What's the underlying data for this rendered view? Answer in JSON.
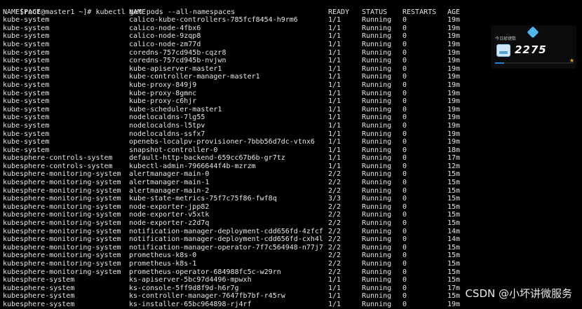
{
  "terminal": {
    "prompt": "[root@master1 ~]#",
    "command": "kubectl get pods --all-namespaces",
    "header": {
      "namespace": "NAMESPACE",
      "name": "NAME",
      "ready": "READY",
      "status": "STATUS",
      "restarts": "RESTARTS",
      "age": "AGE"
    },
    "rows": [
      {
        "namespace": "kube-system",
        "name": "calico-kube-controllers-785fcf8454-h9rm6",
        "ready": "1/1",
        "status": "Running",
        "restarts": "0",
        "age": "19m"
      },
      {
        "namespace": "kube-system",
        "name": "calico-node-4fbx6",
        "ready": "1/1",
        "status": "Running",
        "restarts": "0",
        "age": "19m"
      },
      {
        "namespace": "kube-system",
        "name": "calico-node-9zqp8",
        "ready": "1/1",
        "status": "Running",
        "restarts": "0",
        "age": "19m"
      },
      {
        "namespace": "kube-system",
        "name": "calico-node-zm77d",
        "ready": "1/1",
        "status": "Running",
        "restarts": "0",
        "age": "19m"
      },
      {
        "namespace": "kube-system",
        "name": "coredns-757cd945b-cqzr8",
        "ready": "1/1",
        "status": "Running",
        "restarts": "0",
        "age": "19m"
      },
      {
        "namespace": "kube-system",
        "name": "coredns-757cd945b-nvjwn",
        "ready": "1/1",
        "status": "Running",
        "restarts": "0",
        "age": "19m"
      },
      {
        "namespace": "kube-system",
        "name": "kube-apiserver-master1",
        "ready": "1/1",
        "status": "Running",
        "restarts": "0",
        "age": "19m"
      },
      {
        "namespace": "kube-system",
        "name": "kube-controller-manager-master1",
        "ready": "1/1",
        "status": "Running",
        "restarts": "0",
        "age": "19m"
      },
      {
        "namespace": "kube-system",
        "name": "kube-proxy-849j9",
        "ready": "1/1",
        "status": "Running",
        "restarts": "0",
        "age": "19m"
      },
      {
        "namespace": "kube-system",
        "name": "kube-proxy-8gmnc",
        "ready": "1/1",
        "status": "Running",
        "restarts": "0",
        "age": "19m"
      },
      {
        "namespace": "kube-system",
        "name": "kube-proxy-c6hjr",
        "ready": "1/1",
        "status": "Running",
        "restarts": "0",
        "age": "19m"
      },
      {
        "namespace": "kube-system",
        "name": "kube-scheduler-master1",
        "ready": "1/1",
        "status": "Running",
        "restarts": "0",
        "age": "19m"
      },
      {
        "namespace": "kube-system",
        "name": "nodelocaldns-7lg55",
        "ready": "1/1",
        "status": "Running",
        "restarts": "0",
        "age": "19m"
      },
      {
        "namespace": "kube-system",
        "name": "nodelocaldns-l5tpv",
        "ready": "1/1",
        "status": "Running",
        "restarts": "0",
        "age": "19m"
      },
      {
        "namespace": "kube-system",
        "name": "nodelocaldns-ssfx7",
        "ready": "1/1",
        "status": "Running",
        "restarts": "0",
        "age": "19m"
      },
      {
        "namespace": "kube-system",
        "name": "openebs-localpv-provisioner-7bbb56d7dc-vtnx6",
        "ready": "1/1",
        "status": "Running",
        "restarts": "0",
        "age": "19m"
      },
      {
        "namespace": "kube-system",
        "name": "snapshot-controller-0",
        "ready": "1/1",
        "status": "Running",
        "restarts": "0",
        "age": "18m"
      },
      {
        "namespace": "kubesphere-controls-system",
        "name": "default-http-backend-659cc67b6b-gr7tz",
        "ready": "1/1",
        "status": "Running",
        "restarts": "0",
        "age": "17m"
      },
      {
        "namespace": "kubesphere-controls-system",
        "name": "kubectl-admin-7966644f4b-mzrzm",
        "ready": "1/1",
        "status": "Running",
        "restarts": "0",
        "age": "12m"
      },
      {
        "namespace": "kubesphere-monitoring-system",
        "name": "alertmanager-main-0",
        "ready": "2/2",
        "status": "Running",
        "restarts": "0",
        "age": "15m"
      },
      {
        "namespace": "kubesphere-monitoring-system",
        "name": "alertmanager-main-1",
        "ready": "2/2",
        "status": "Running",
        "restarts": "0",
        "age": "15m"
      },
      {
        "namespace": "kubesphere-monitoring-system",
        "name": "alertmanager-main-2",
        "ready": "2/2",
        "status": "Running",
        "restarts": "0",
        "age": "15m"
      },
      {
        "namespace": "kubesphere-monitoring-system",
        "name": "kube-state-metrics-75f7c75f86-fwf8q",
        "ready": "3/3",
        "status": "Running",
        "restarts": "0",
        "age": "15m"
      },
      {
        "namespace": "kubesphere-monitoring-system",
        "name": "node-exporter-jpp82",
        "ready": "2/2",
        "status": "Running",
        "restarts": "0",
        "age": "15m"
      },
      {
        "namespace": "kubesphere-monitoring-system",
        "name": "node-exporter-v5xtk",
        "ready": "2/2",
        "status": "Running",
        "restarts": "0",
        "age": "15m"
      },
      {
        "namespace": "kubesphere-monitoring-system",
        "name": "node-exporter-z2d7q",
        "ready": "2/2",
        "status": "Running",
        "restarts": "0",
        "age": "15m"
      },
      {
        "namespace": "kubesphere-monitoring-system",
        "name": "notification-manager-deployment-cdd656fd-4zfcf",
        "ready": "2/2",
        "status": "Running",
        "restarts": "0",
        "age": "14m"
      },
      {
        "namespace": "kubesphere-monitoring-system",
        "name": "notification-manager-deployment-cdd656fd-cxh4l",
        "ready": "2/2",
        "status": "Running",
        "restarts": "0",
        "age": "14m"
      },
      {
        "namespace": "kubesphere-monitoring-system",
        "name": "notification-manager-operator-7f7c564948-n77j7",
        "ready": "2/2",
        "status": "Running",
        "restarts": "0",
        "age": "15m"
      },
      {
        "namespace": "kubesphere-monitoring-system",
        "name": "prometheus-k8s-0",
        "ready": "2/2",
        "status": "Running",
        "restarts": "0",
        "age": "15m"
      },
      {
        "namespace": "kubesphere-monitoring-system",
        "name": "prometheus-k8s-1",
        "ready": "2/2",
        "status": "Running",
        "restarts": "0",
        "age": "15m"
      },
      {
        "namespace": "kubesphere-monitoring-system",
        "name": "prometheus-operator-684988fc5c-w29rn",
        "ready": "2/2",
        "status": "Running",
        "restarts": "0",
        "age": "15m"
      },
      {
        "namespace": "kubesphere-system",
        "name": "ks-apiserver-5bc97d4496-mpwxh",
        "ready": "1/1",
        "status": "Running",
        "restarts": "0",
        "age": "15m"
      },
      {
        "namespace": "kubesphere-system",
        "name": "ks-console-5ff9d8f9d-h6r7g",
        "ready": "1/1",
        "status": "Running",
        "restarts": "0",
        "age": "17m"
      },
      {
        "namespace": "kubesphere-system",
        "name": "ks-controller-manager-7647fb7bf-r45rw",
        "ready": "1/1",
        "status": "Running",
        "restarts": "0",
        "age": "15m"
      },
      {
        "namespace": "kubesphere-system",
        "name": "ks-installer-65bc964898-rj4rf",
        "ready": "1/1",
        "status": "Running",
        "restarts": "0",
        "age": "19m"
      }
    ]
  },
  "widget": {
    "label": "今日敲键数",
    "count": "2275",
    "progress": 0.12,
    "accent": "#4fb7f0"
  },
  "watermark": "CSDN @小坏讲微服务"
}
